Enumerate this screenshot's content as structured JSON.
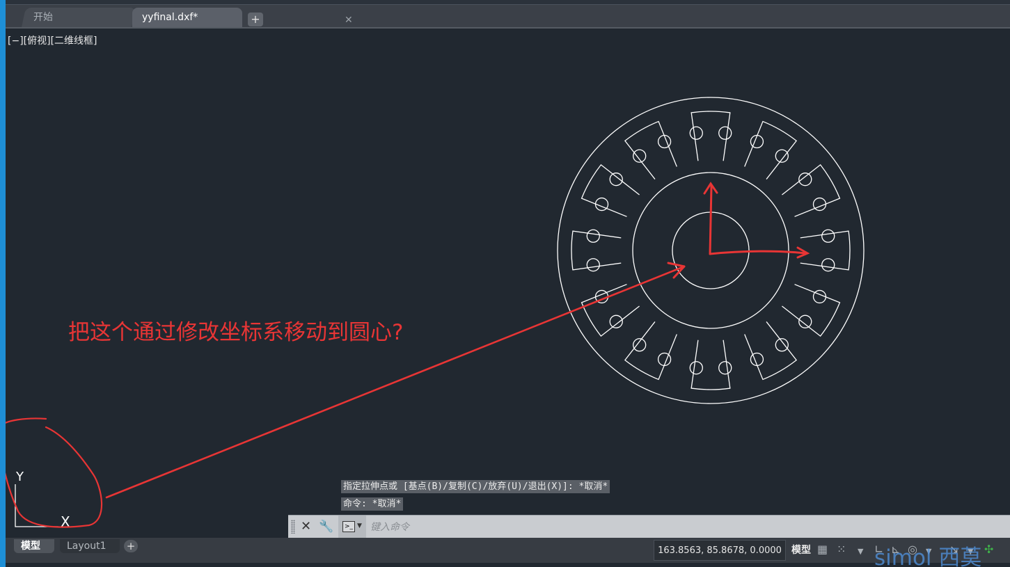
{
  "tabs": {
    "start_label": "开始",
    "doc_label": "yyfinal.dxf*",
    "close_glyph": "✕",
    "new_glyph": "+"
  },
  "viewport": {
    "label": "[−][俯视][二维线框]"
  },
  "ucs": {
    "x_label": "X",
    "y_label": "Y"
  },
  "annotation": {
    "question": "把这个通过修改坐标系移动到圆心?",
    "color": "#e83535"
  },
  "command": {
    "history": [
      "指定拉伸点或 [基点(B)/复制(C)/放弃(U)/退出(X)]: *取消*",
      "命令: *取消*"
    ],
    "placeholder": "键入命令"
  },
  "layout_tabs": {
    "model": "模型",
    "layout1": "Layout1",
    "add_glyph": "+"
  },
  "status": {
    "coordinates": "163.8563, 85.8678, 0.0000",
    "space": "模型"
  },
  "watermark": "simol 西莫",
  "colors": {
    "canvas": "#212830",
    "drawing_lines": "#ffffff",
    "markup": "#e83535"
  }
}
